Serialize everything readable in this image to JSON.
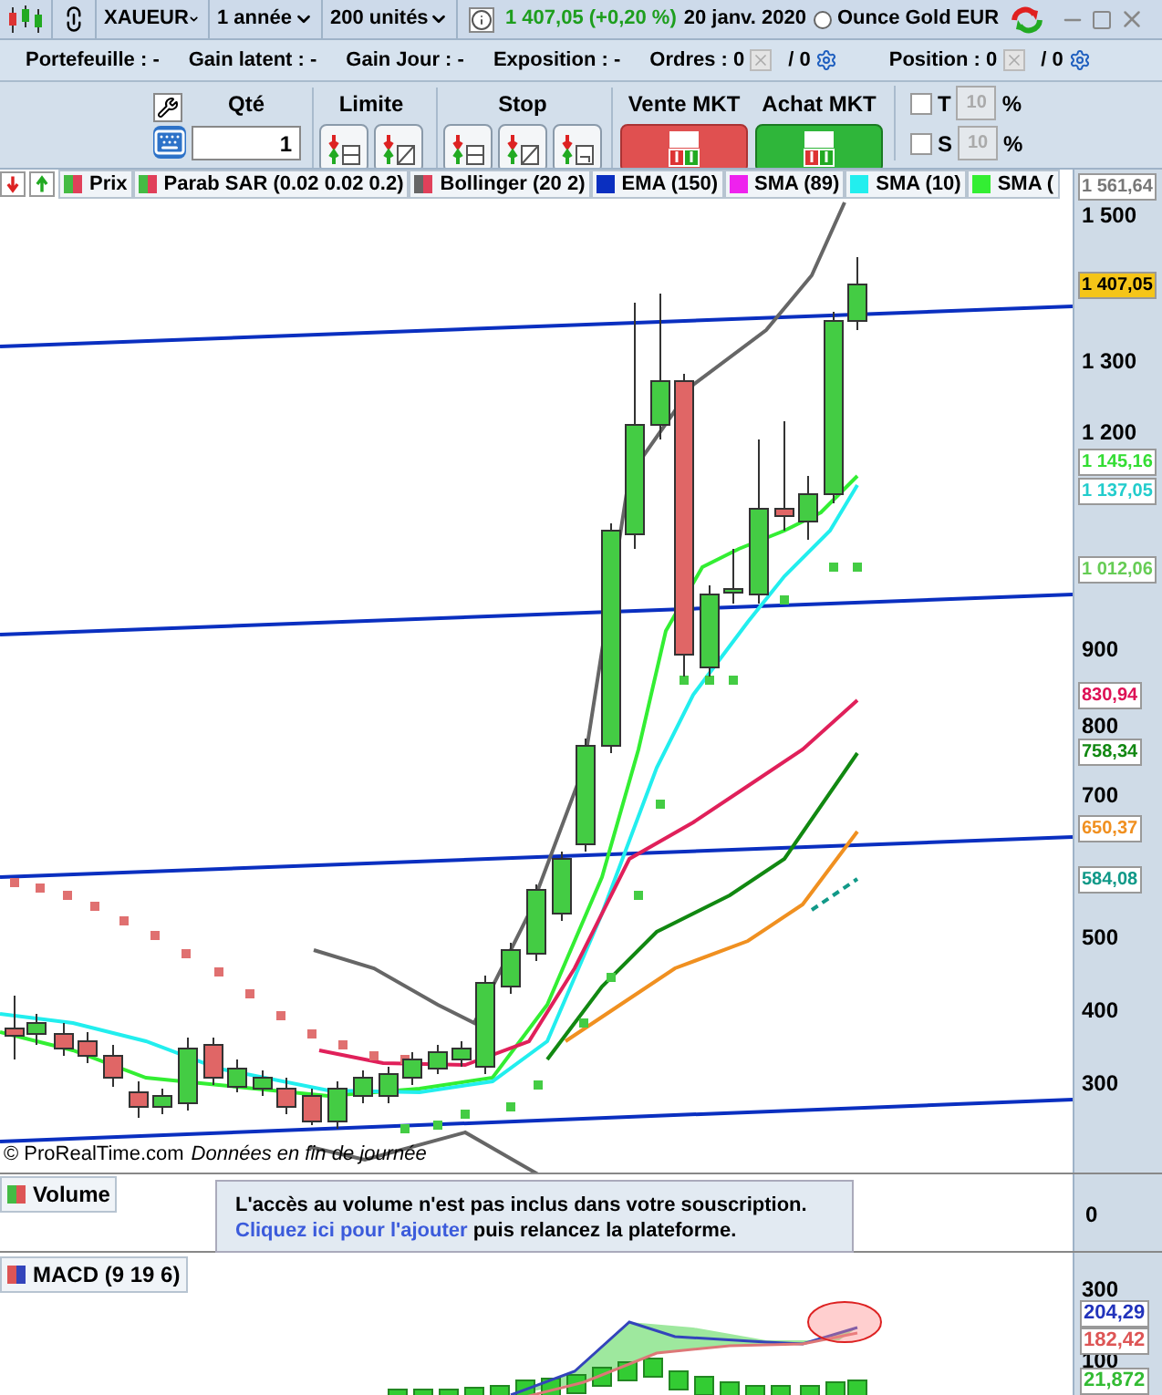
{
  "toolbar": {
    "symbol": "XAUEUR",
    "period": "1 année",
    "units": "200 unités",
    "price": "1 407,05 (+0,20 %)",
    "date": "20 janv. 2020",
    "instrument": {
      "label": "Ounce Gold EUR",
      "selected": false
    }
  },
  "account": [
    {
      "label": "Portefeuille :",
      "value": "-"
    },
    {
      "label": "Gain latent :",
      "value": "-"
    },
    {
      "label": "Gain Jour :",
      "value": "-"
    },
    {
      "label": "Exposition :",
      "value": "-"
    }
  ],
  "orders": [
    {
      "label": "Ordres :",
      "count": "0",
      "pending": "/ 0"
    },
    {
      "label": "Position :",
      "count": "0",
      "pending": "/ 0"
    }
  ],
  "order_panel": {
    "qty_label": "Qté",
    "qty": "1",
    "limit_label": "Limite",
    "stop_label": "Stop",
    "sell": "Vente MKT",
    "buy": "Achat MKT",
    "options": [
      {
        "label": "T",
        "checked": false,
        "value": "10",
        "unit": "%",
        "disabled": true
      },
      {
        "label": "S",
        "checked": false,
        "value": "10",
        "unit": "%",
        "disabled": true
      }
    ]
  },
  "legend": [
    {
      "label": "Prix",
      "color": "#44bb44",
      "kind": "split"
    },
    {
      "label": "Parab SAR (0.02 0.02 0.2)",
      "color": "#44bb44",
      "kind": "split"
    },
    {
      "label": "Bollinger (20 2)",
      "color": "#666666",
      "kind": "split"
    },
    {
      "label": "EMA (150)",
      "color": "#0a2fc0",
      "kind": "solid"
    },
    {
      "label": "SMA (89)",
      "color": "#ee22ee",
      "kind": "solid"
    },
    {
      "label": "SMA (10)",
      "color": "#22eeee",
      "kind": "solid"
    },
    {
      "label": "SMA (",
      "color": "#33ee33",
      "kind": "solid"
    }
  ],
  "main_axis": {
    "ticks": [
      "1 500",
      "1 300",
      "1 200",
      "900",
      "800",
      "700",
      "500",
      "400",
      "300"
    ],
    "tags": [
      {
        "text": "1 561,64",
        "color": "#777777",
        "kind": "outline"
      },
      {
        "text": "1 407,05",
        "color": "#f5c518",
        "kind": "filled"
      },
      {
        "text": "1 145,16",
        "color": "#33dd33",
        "kind": "outline"
      },
      {
        "text": "1 137,05",
        "color": "#22cccc",
        "kind": "outline"
      },
      {
        "text": "1 012,06",
        "color": "#66cc55",
        "kind": "outline"
      },
      {
        "text": "830,94",
        "color": "#dd1155",
        "kind": "outline"
      },
      {
        "text": "758,34",
        "color": "#118811",
        "kind": "outline"
      },
      {
        "text": "650,37",
        "color": "#f09020",
        "kind": "outline"
      },
      {
        "text": "584,08",
        "color": "#119988",
        "kind": "outline"
      }
    ]
  },
  "credit": {
    "site": "© ProRealTime.com",
    "note": "Données en fin de journée"
  },
  "volume": {
    "label": "Volume",
    "axis": "0",
    "message": "L'accès au volume n'est pas inclus dans votre souscription.",
    "link": "Cliquez ici pour l'ajouter",
    "message_end": "puis relancez la plateforme."
  },
  "macd": {
    "label": "MACD (9 19 6)",
    "ticks": [
      "300",
      "100"
    ],
    "tags": [
      {
        "text": "204,29",
        "color": "#2233bb"
      },
      {
        "text": "182,42",
        "color": "#dd5555"
      },
      {
        "text": "21,872",
        "color": "#33bb33"
      }
    ]
  }
}
